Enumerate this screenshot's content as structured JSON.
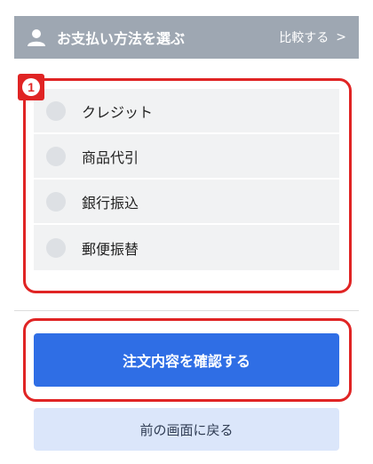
{
  "header": {
    "icon": "user-icon",
    "title": "お支払い方法を選ぶ",
    "compare_label": "比較する",
    "compare_icon": "chevron-right-icon"
  },
  "badge": {
    "number": "1"
  },
  "payment_options": [
    {
      "label": "クレジット",
      "selected": false
    },
    {
      "label": "商品代引",
      "selected": false
    },
    {
      "label": "銀行振込",
      "selected": false
    },
    {
      "label": "郵便振替",
      "selected": false
    }
  ],
  "actions": {
    "confirm_label": "注文内容を確認する",
    "back_label": "前の画面に戻る"
  },
  "colors": {
    "header_bg": "#9ea7b2",
    "highlight": "#e02424",
    "primary": "#2f6ee5",
    "secondary_bg": "#dbe6fa",
    "option_bg": "#f1f2f3"
  }
}
